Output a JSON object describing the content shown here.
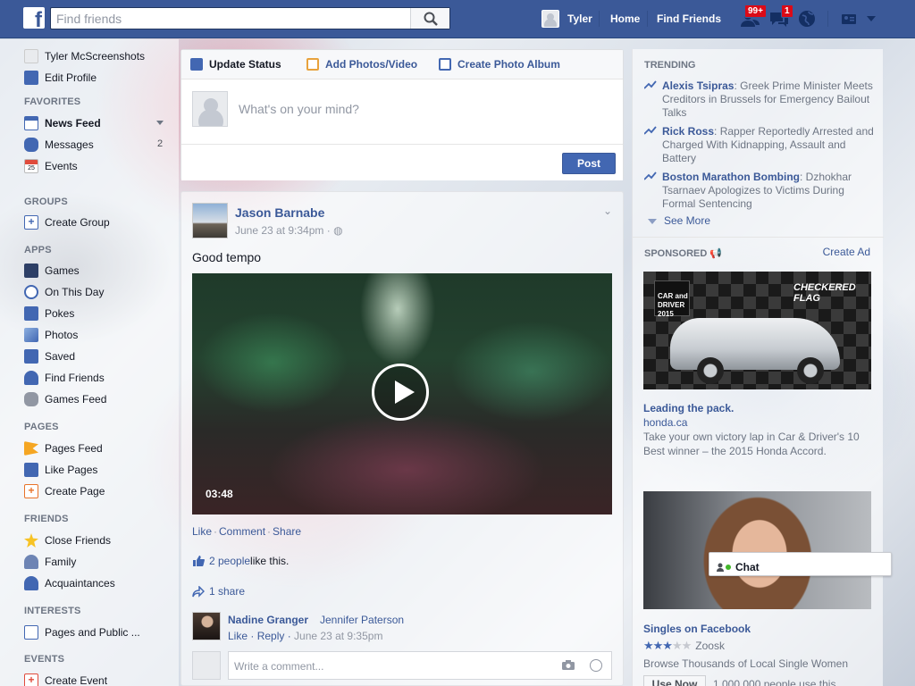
{
  "topbar": {
    "search_placeholder": "Find friends",
    "user_name": "Tyler",
    "nav_home": "Home",
    "nav_find_friends": "Find Friends",
    "friend_requests_badge": "99+",
    "notifications_badge": "1"
  },
  "left_nav": {
    "profile_name": "Tyler McScreenshots",
    "edit_profile": "Edit Profile",
    "favorites_heading": "FAVORITES",
    "favorites": [
      {
        "label": "News Feed"
      },
      {
        "label": "Messages",
        "count": "2"
      },
      {
        "label": "Events"
      }
    ],
    "groups_heading": "GROUPS",
    "create_group": "Create Group",
    "apps_heading": "APPS",
    "apps": [
      {
        "label": "Games"
      },
      {
        "label": "On This Day"
      },
      {
        "label": "Pokes"
      },
      {
        "label": "Photos"
      },
      {
        "label": "Saved"
      },
      {
        "label": "Find Friends"
      },
      {
        "label": "Games Feed"
      }
    ],
    "pages_heading": "PAGES",
    "pages": [
      {
        "label": "Pages Feed"
      },
      {
        "label": "Like Pages"
      },
      {
        "label": "Create Page"
      }
    ],
    "friends_heading": "FRIENDS",
    "friends": [
      {
        "label": "Close Friends"
      },
      {
        "label": "Family"
      },
      {
        "label": "Acquaintances"
      }
    ],
    "interests_heading": "INTERESTS",
    "interests": [
      {
        "label": "Pages and Public ..."
      }
    ],
    "events_heading": "EVENTS",
    "create_event": "Create Event"
  },
  "composer": {
    "tab_update_status": "Update Status",
    "tab_add_photos": "Add Photos/Video",
    "tab_create_album": "Create Photo Album",
    "placeholder": "What's on your mind?",
    "post_button": "Post"
  },
  "post": {
    "author": "Jason Barnabe",
    "time": "June 23 at 9:34pm",
    "text": "Good tempo",
    "video_duration": "03:48",
    "action_like": "Like",
    "action_comment": "Comment",
    "action_share": "Share",
    "likes_link": "2 people",
    "likes_suffix": " like this.",
    "shares": "1 share",
    "comment": {
      "author": "Nadine Granger",
      "text": "Jennifer Paterson",
      "like": "Like",
      "reply": "Reply",
      "time": "June 23 at 9:35pm"
    },
    "write_comment_placeholder": "Write a comment..."
  },
  "right": {
    "trending_heading": "TRENDING",
    "trending": [
      {
        "name": "Alexis Tsipras",
        "desc": ": Greek Prime Minister Meets Creditors in Brussels for Emergency Bailout Talks"
      },
      {
        "name": "Rick Ross",
        "desc": ": Rapper Reportedly Arrested and Charged With Kidnapping, Assault and Battery"
      },
      {
        "name": "Boston Marathon Bombing",
        "desc": ": Dzhokhar Tsarnaev Apologizes to Victims During Formal Sentencing"
      }
    ],
    "see_more": "See More",
    "sponsored_heading": "SPONSORED",
    "create_ad": "Create Ad",
    "ads": [
      {
        "title": "Leading the pack.",
        "domain": "honda.ca",
        "desc": "Take your own victory lap in Car & Driver's 10 Best winner – the 2015 Honda Accord.",
        "img_text_1": "CAR and DRIVER 2015",
        "img_text_2": "CHECKERED FLAG"
      },
      {
        "title": "Singles on Facebook",
        "rating": 3.5,
        "advertiser": "Zoosk",
        "desc": "Browse Thousands of Local Single Women",
        "button": "Use Now",
        "count": "1,000,000 people use this."
      }
    ]
  },
  "chat": {
    "label": "Chat"
  },
  "colors": {
    "brand": "#3b5998",
    "badge": "#dc0a17",
    "online": "#42b72a"
  }
}
